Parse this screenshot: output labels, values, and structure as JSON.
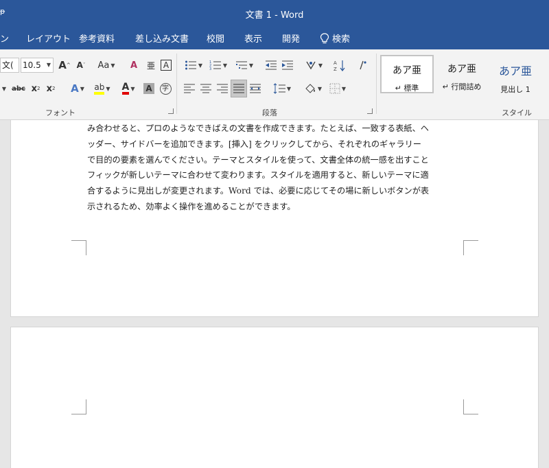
{
  "window": {
    "title": "文書 1  -  Word",
    "qat_glyph": "ᵽ"
  },
  "tabs": [
    {
      "label": "ン"
    },
    {
      "label": "レイアウト"
    },
    {
      "label": "参考資料"
    },
    {
      "label": "差し込み文書"
    },
    {
      "label": "校閲"
    },
    {
      "label": "表示"
    },
    {
      "label": "開発"
    },
    {
      "label": "検索"
    }
  ],
  "font_group": {
    "label": "フォント",
    "font_name": "文(",
    "font_size": "10.5",
    "grow_font": "A",
    "shrink_font": "A",
    "change_case": "Aa",
    "clear_format": "A",
    "phonetic": "亜",
    "char_border": "A",
    "strikethrough": "abc",
    "subscript": "x",
    "superscript": "x",
    "text_effects": "A",
    "highlight": "ab",
    "font_color": "A",
    "char_shading": "A",
    "enclose": "字"
  },
  "paragraph_group": {
    "label": "段落"
  },
  "styles_group": {
    "label": "スタイル",
    "items": [
      {
        "sample": "あア亜",
        "name": "↵ 標準"
      },
      {
        "sample": "あア亜",
        "name": "↵ 行間詰め"
      },
      {
        "sample": "あア亜",
        "name": "見出し 1"
      }
    ]
  },
  "colors": {
    "title_bar": "#2b579a",
    "ribbon": "#f3f3f3",
    "highlight_yellow": "#ffff00",
    "font_red": "#e00000",
    "selected_blue": "#2b579a"
  },
  "document": {
    "lines": [
      "み合わせると、プロのようなできばえの文書を作成できます。たとえば、一致する表紙、ヘ",
      "ッダー、サイドバーを追加できます。[挿入] をクリックしてから、それぞれのギャラリー",
      "で目的の要素を選んでください。テーマとスタイルを使って、文書全体の統一感を出すこと",
      "フィックが新しいテーマに合わせて変わります。スタイルを適用すると、新しいテーマに適",
      "合するように見出しが変更されます。Word  では、必要に応じてその場に新しいボタンが表",
      "示されるため、効率よく操作を進めることができます。"
    ]
  }
}
